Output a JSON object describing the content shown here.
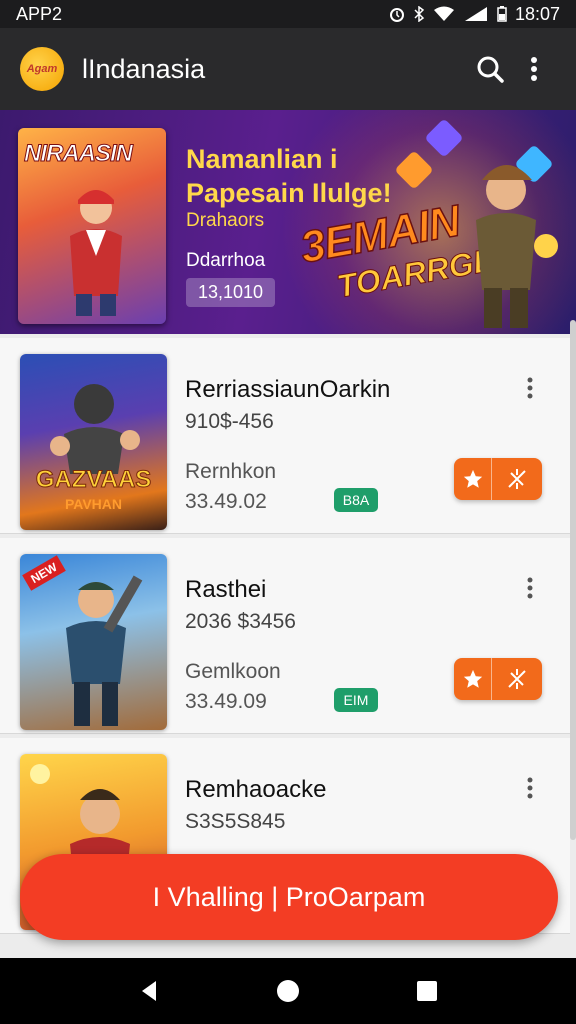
{
  "status_bar": {
    "carrier": "APP2",
    "time": "18:07"
  },
  "app_bar": {
    "logo_text": "Agam",
    "title": "lIndanasia"
  },
  "banner": {
    "poster_title": "NIRAASIN",
    "title_line1": "Namanlian i",
    "title_line2": "Papesain Ilulge!",
    "subtitle": "Drahaors",
    "label": "Ddarrhoa",
    "badge": "13,1010",
    "promo_line1": "3EMAIN",
    "promo_line2": "TOARRGE!"
  },
  "games": [
    {
      "title": "RerriassiaunOarkin",
      "price": "910$-456",
      "label": "Rernhkon",
      "value": "33.49.02",
      "tag": "B8A",
      "thumb_text": "GAZVAAS",
      "thumb_sub": "PAVHAN",
      "ribbon": ""
    },
    {
      "title": "Rasthei",
      "price": "2036 $3456",
      "label": "Gemlkoon",
      "value": "33.49.09",
      "tag": "EIM",
      "thumb_text": "",
      "thumb_sub": "",
      "ribbon": "NEW"
    },
    {
      "title": "Remhaoacke",
      "price": "S3S5S845",
      "label": "",
      "value": "",
      "tag": "",
      "thumb_text": "",
      "thumb_sub": "",
      "ribbon": ""
    }
  ],
  "fab": {
    "label": "I Vhalling | ProOarpam"
  },
  "colors": {
    "accent": "#f33d24",
    "action": "#f26a1b",
    "tag": "#1f9e6a",
    "appbar": "#2a2a2c"
  }
}
